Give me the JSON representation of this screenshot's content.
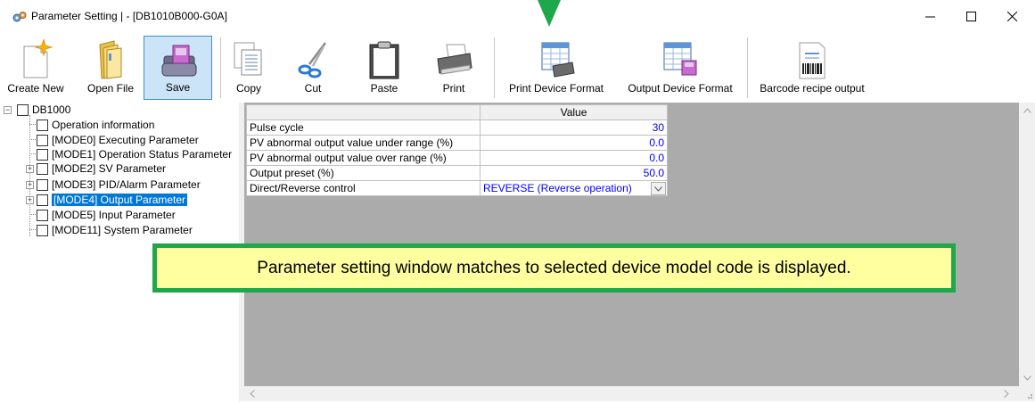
{
  "window": {
    "title": "Parameter Setting |  - [DB1010B000-G0A]",
    "controls": {
      "minimize": "—",
      "maximize": "☐",
      "close": "✕"
    },
    "app_icon": "gears-icon"
  },
  "toolbar": {
    "buttons": [
      {
        "id": "create-new",
        "label": "Create New",
        "icon": "new-document-icon"
      },
      {
        "id": "open-file",
        "label": "Open File",
        "icon": "folder-icon"
      },
      {
        "id": "save",
        "label": "Save",
        "icon": "floppy-disk-icon",
        "pressed": true
      },
      {
        "id": "copy",
        "label": "Copy",
        "icon": "copy-icon"
      },
      {
        "id": "cut",
        "label": "Cut",
        "icon": "scissors-icon"
      },
      {
        "id": "paste",
        "label": "Paste",
        "icon": "clipboard-icon"
      },
      {
        "id": "print",
        "label": "Print",
        "icon": "printer-icon"
      },
      {
        "id": "print-device-format",
        "label": "Print Device Format",
        "icon": "print-format-icon"
      },
      {
        "id": "output-device-format",
        "label": "Output Device Format",
        "icon": "output-format-icon"
      },
      {
        "id": "barcode-recipe-output",
        "label": "Barcode recipe output",
        "icon": "barcode-icon"
      }
    ]
  },
  "tree": {
    "root": "DB1000",
    "items": [
      {
        "label": "Operation information",
        "expandable": false
      },
      {
        "label": "[MODE0] Executing Parameter",
        "expandable": false
      },
      {
        "label": "[MODE1] Operation Status Parameter",
        "expandable": false
      },
      {
        "label": "[MODE2] SV Parameter",
        "expandable": true
      },
      {
        "label": "[MODE3] PID/Alarm Parameter",
        "expandable": true
      },
      {
        "label": "[MODE4] Output Parameter",
        "expandable": true,
        "selected": true
      },
      {
        "label": "[MODE5] Input Parameter",
        "expandable": false
      },
      {
        "label": "[MODE11] System Parameter",
        "expandable": false
      }
    ]
  },
  "grid": {
    "column_header": "Value",
    "rows": [
      {
        "name": "Pulse cycle",
        "value": "30"
      },
      {
        "name": "PV abnormal output value under range (%)",
        "value": "0.0"
      },
      {
        "name": "PV abnormal output value over range (%)",
        "value": "0.0"
      },
      {
        "name": "Output preset (%)",
        "value": "50.0"
      },
      {
        "name": "Direct/Reverse control",
        "value": "REVERSE (Reverse operation)",
        "dropdown": true
      }
    ]
  },
  "callout": {
    "text": "Parameter setting window matches to selected device model code is displayed."
  },
  "colors": {
    "callout_border": "#1ea84b",
    "callout_fill": "#ffffa0",
    "selection": "#0078d7",
    "value_text": "#0000ff",
    "grid_background": "#ababab"
  }
}
